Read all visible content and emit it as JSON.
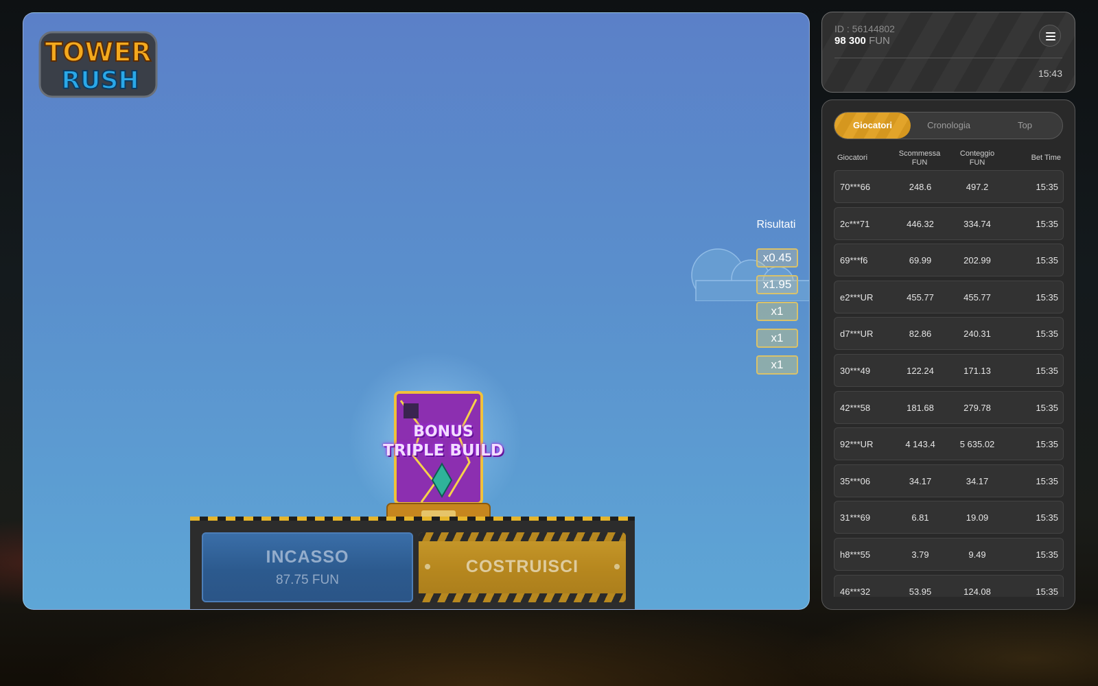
{
  "game": {
    "logo_line1": "TOWER",
    "logo_line2": "RUSH",
    "results_label": "Risultati",
    "results": [
      "x0.45",
      "x1.95",
      "x1",
      "x1",
      "x1"
    ],
    "bonus_line1": "BONUS",
    "bonus_line2": "TRIPLE BUILD",
    "cashout_label": "INCASSO",
    "cashout_value": "87.75",
    "cashout_currency": "FUN",
    "build_label": "COSTRUISCI"
  },
  "account": {
    "id": "ID : 56144802",
    "balance": "98 300",
    "currency": "FUN",
    "time": "15:43"
  },
  "players_panel": {
    "tabs": [
      "Giocatori",
      "Cronologia",
      "Top"
    ],
    "active_tab": "Giocatori",
    "columns": {
      "player": "Giocatori",
      "bet_line1": "Scommessa",
      "bet_line2": "FUN",
      "win_line1": "Conteggio",
      "win_line2": "FUN",
      "time": "Bet Time"
    },
    "rows": [
      {
        "player": "70***66",
        "bet": "248.6",
        "win": "497.2",
        "time": "15:35"
      },
      {
        "player": "2c***71",
        "bet": "446.32",
        "win": "334.74",
        "time": "15:35"
      },
      {
        "player": "69***f6",
        "bet": "69.99",
        "win": "202.99",
        "time": "15:35"
      },
      {
        "player": "e2***UR",
        "bet": "455.77",
        "win": "455.77",
        "time": "15:35"
      },
      {
        "player": "d7***UR",
        "bet": "82.86",
        "win": "240.31",
        "time": "15:35"
      },
      {
        "player": "30***49",
        "bet": "122.24",
        "win": "171.13",
        "time": "15:35"
      },
      {
        "player": "42***58",
        "bet": "181.68",
        "win": "279.78",
        "time": "15:35"
      },
      {
        "player": "92***UR",
        "bet": "4 143.4",
        "win": "5 635.02",
        "time": "15:35"
      },
      {
        "player": "35***06",
        "bet": "34.17",
        "win": "34.17",
        "time": "15:35"
      },
      {
        "player": "31***69",
        "bet": "6.81",
        "win": "19.09",
        "time": "15:35"
      },
      {
        "player": "h8***55",
        "bet": "3.79",
        "win": "9.49",
        "time": "15:35"
      },
      {
        "player": "46***32",
        "bet": "53.95",
        "win": "124.08",
        "time": "15:35"
      }
    ]
  },
  "colors": {
    "accent": "#e2a42a",
    "cashout": "#3a6ea8",
    "build": "#b7881f",
    "sky": "#5a8fcc",
    "panel": "#292929"
  }
}
